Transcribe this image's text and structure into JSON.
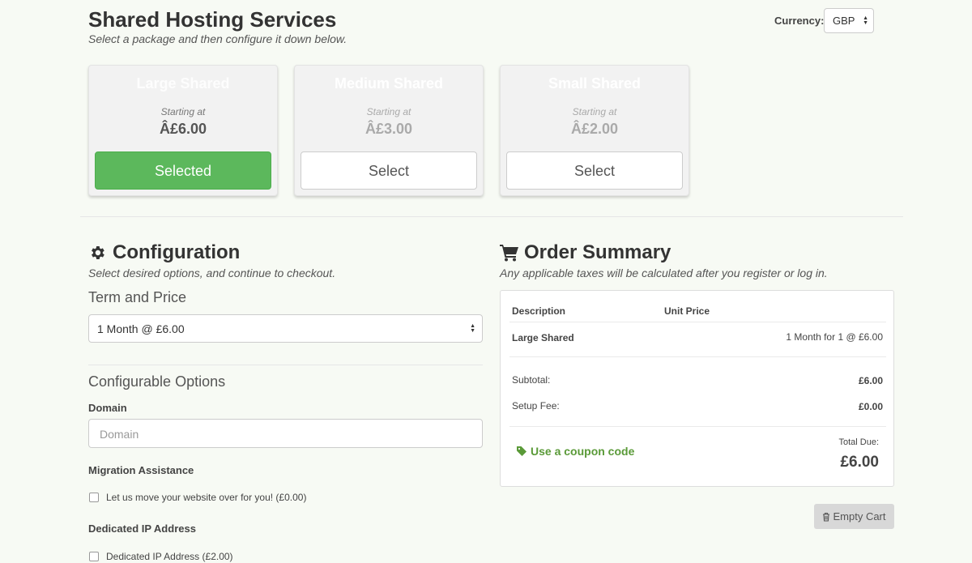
{
  "header": {
    "title": "Shared Hosting Services",
    "subtitle": "Select a package and then configure it down below.",
    "currency_label": "Currency:",
    "currency_value": "GBP"
  },
  "packages": [
    {
      "name": "Large Shared",
      "starting_at": "Starting at",
      "price": "Â£6.00",
      "button": "Selected",
      "selected": true
    },
    {
      "name": "Medium Shared",
      "starting_at": "Starting at",
      "price": "Â£3.00",
      "button": "Select",
      "selected": false
    },
    {
      "name": "Small Shared",
      "starting_at": "Starting at",
      "price": "Â£2.00",
      "button": "Select",
      "selected": false
    }
  ],
  "configuration": {
    "title": "Configuration",
    "subtitle": "Select desired options, and continue to checkout.",
    "term_label": "Term and Price",
    "term_value": "1 Month @ £6.00",
    "options_title": "Configurable Options",
    "domain_label": "Domain",
    "domain_placeholder": "Domain",
    "migration_label": "Migration Assistance",
    "migration_option": "Let us move your website over for you! (£0.00)",
    "ip_label": "Dedicated IP Address",
    "ip_option": "Dedicated IP Address (£2.00)"
  },
  "summary": {
    "title": "Order Summary",
    "subtitle": "Any applicable taxes will be calculated after you register or log in.",
    "col_description": "Description",
    "col_unit_price": "Unit Price",
    "item_name": "Large Shared",
    "item_price": "1 Month for 1 @ £6.00",
    "subtotal_label": "Subtotal:",
    "subtotal_value": "£6.00",
    "setup_label": "Setup Fee:",
    "setup_value": "£0.00",
    "coupon_link": "Use a coupon code",
    "total_label": "Total Due:",
    "total_value": "£6.00",
    "empty_cart": "Empty Cart"
  },
  "colors": {
    "accent_green": "#5cb85c",
    "link_green": "#5a9a38",
    "background": "#f7faf4"
  }
}
